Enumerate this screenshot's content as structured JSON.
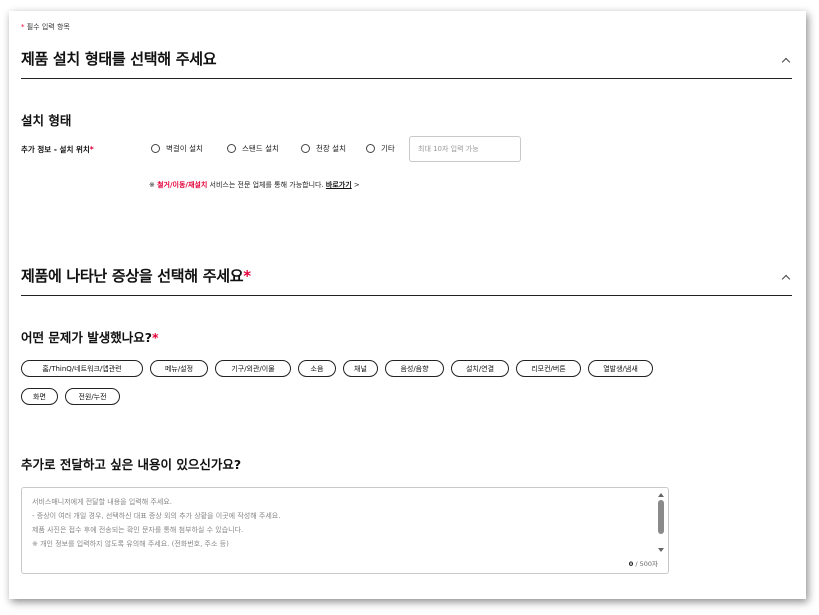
{
  "required_note": {
    "star": "*",
    "text": "필수 입력 항목"
  },
  "install_section": {
    "title": "제품 설치 형태를 선택해 주세요",
    "subtitle": "설치 형태",
    "field_label": "추가 정보 - 설치 위치",
    "field_star": "*",
    "options": [
      "벽걸이 설치",
      "스탠드 설치",
      "천장 설치",
      "기타"
    ],
    "other_placeholder": "최대 10자 입력 가능",
    "notice": {
      "prefix": "※ ",
      "highlight": "철거/이동/재설치",
      "middle": " 서비스는 전문 업체를 통해 가능합니다. ",
      "link": "바로가기",
      "arrow": ">"
    }
  },
  "symptom_section": {
    "title": "제품에 나타난 증상을 선택해 주세요",
    "title_star": "*",
    "question": "어떤 문제가 발생했나요?",
    "question_star": "*",
    "chips": [
      "홈/ThinQ/네트워크/앱관련",
      "메뉴/설정",
      "기구/외관/이물",
      "소음",
      "채널",
      "음성/음향",
      "설치/연결",
      "리모컨/버튼",
      "열발생/냄새",
      "화면",
      "전원/누전"
    ]
  },
  "extra_section": {
    "title": "추가로 전달하고 싶은 내용이 있으신가요?",
    "placeholder_lines": [
      "서비스매니저에게 전달할 내용을 입력해 주세요.",
      "- 증상이 여러 개일 경우, 선택하신 대표 증상 외의 추가 상황을 이곳에 작성해 주세요.",
      "제품 사진은 접수 후에 전송되는 확인 문자를 통해 첨부하실 수 있습니다.",
      "※ 개인 정보를 입력하지 않도록 유의해 주세요. (전화번호, 주소 등)"
    ],
    "char_count": "0",
    "char_max": " / 500자"
  },
  "icons": {
    "collapse": "chevron-up-icon",
    "radio": "radio-unchecked-icon",
    "link_arrow": "chevron-right-icon"
  },
  "colors": {
    "accent": "#e4003a",
    "text": "#111111",
    "border": "#c9c9c9"
  }
}
